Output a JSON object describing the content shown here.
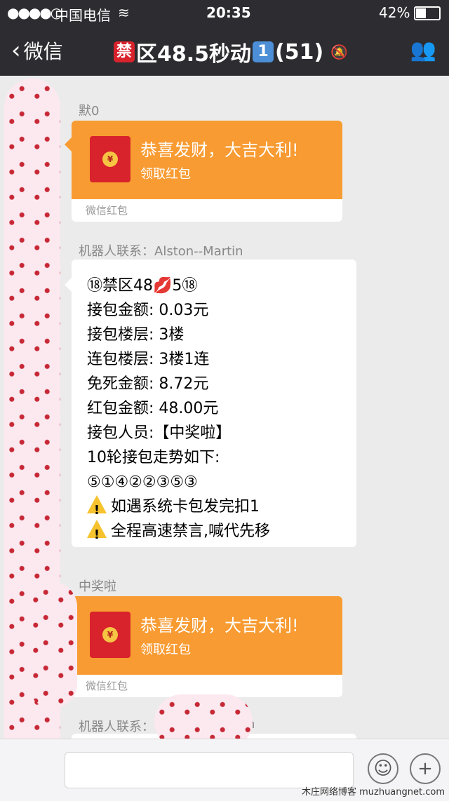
{
  "status": {
    "signal": "●●●●○",
    "carrier": "中国电信",
    "wifi": "≋",
    "time": "20:35",
    "battery": "42%"
  },
  "nav": {
    "back": "微信",
    "title_box1": "禁",
    "title_main": "区48.5秒动",
    "title_box2": "1",
    "title_count": "(51)",
    "mute_icon": "🔕",
    "contacts_icon": "👥"
  },
  "messages": [
    {
      "sender": "默0",
      "redpacket": {
        "title": "恭喜发财，大吉大利!",
        "sub": "领取红包",
        "footer": "微信红包"
      }
    },
    {
      "sender": "机器人联系：Alston--Martin",
      "lines": [
        "⑱禁区48💋5⑱",
        "接包金额: 0.03元",
        "接包楼层: 3楼",
        "连包楼层: 3楼1连",
        "免死金额: 8.72元",
        "红包金额: 48.00元",
        "接包人员:【中奖啦】",
        "10轮接包走势如下:",
        "⑤①④②②③⑤③"
      ],
      "warnings": [
        "如遇系统卡包发完扣1",
        "全程高速禁言,喊代先移"
      ]
    },
    {
      "sender": "中奖啦",
      "redpacket": {
        "title": "恭喜发财，大吉大利!",
        "sub": "领取红包",
        "footer": "微信红包"
      }
    },
    {
      "sender": "机器人联系：",
      "sender_tail": "n"
    }
  ],
  "input": {
    "emoji": "☺",
    "plus": "+"
  },
  "watermark": "木庄网络博客 muzhuangnet.com"
}
